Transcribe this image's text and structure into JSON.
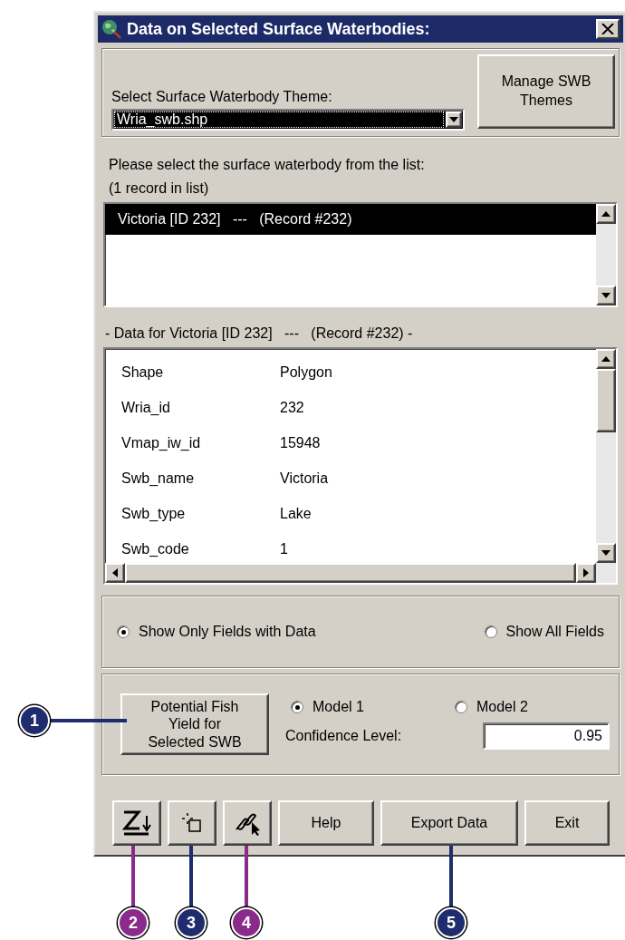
{
  "window": {
    "title": "Data on Selected Surface Waterbodies:"
  },
  "theme_selector": {
    "label": "Select Surface Waterbody Theme:",
    "value": "Wria_swb.shp"
  },
  "manage_button": "Manage SWB Themes",
  "waterbody_list": {
    "prompt": "Please select the surface waterbody from the list:",
    "count": "(1 record in list)",
    "items": [
      {
        "label": "Victoria [ID 232]   ---   (Record #232)",
        "selected": true
      }
    ]
  },
  "data_table": {
    "heading": "- Data for Victoria [ID 232]   ---   (Record #232) -",
    "rows": [
      {
        "field": "Shape",
        "value": "Polygon"
      },
      {
        "field": "Wria_id",
        "value": "232"
      },
      {
        "field": "Vmap_iw_id",
        "value": "15948"
      },
      {
        "field": "Swb_name",
        "value": "Victoria"
      },
      {
        "field": "Swb_type",
        "value": "Lake"
      },
      {
        "field": "Swb_code",
        "value": "1"
      }
    ]
  },
  "field_filter": [
    {
      "label": "Show Only Fields with Data",
      "selected": true
    },
    {
      "label": "Show All Fields",
      "selected": false
    }
  ],
  "fish_yield": {
    "button": "Potential Fish Yield for Selected SWB",
    "models": [
      {
        "label": "Model 1",
        "selected": true
      },
      {
        "label": "Model 2",
        "selected": false
      }
    ],
    "confidence_label": "Confidence Level:",
    "confidence_value": "0.95"
  },
  "tool_buttons": [
    {
      "kind": "sort"
    },
    {
      "kind": "select"
    },
    {
      "kind": "link"
    }
  ],
  "buttons": [
    "Help",
    "Export Data",
    "Exit"
  ],
  "callouts": [
    {
      "label": "1",
      "color": "#1f2d6e"
    },
    {
      "label": "2",
      "color": "#8a2b8c"
    },
    {
      "label": "3",
      "color": "#1f2d6e"
    },
    {
      "label": "4",
      "color": "#8a2b8c"
    },
    {
      "label": "5",
      "color": "#1f2d6e"
    }
  ]
}
